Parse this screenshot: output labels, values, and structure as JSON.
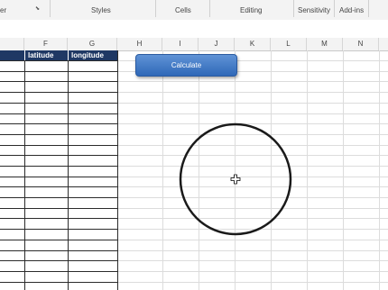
{
  "ribbon": {
    "groups": [
      "er",
      "Styles",
      "Cells",
      "Editing",
      "Sensitivity",
      "Add-ins"
    ],
    "launcher_icon": "dialog-launcher-icon"
  },
  "columns": [
    "F",
    "G",
    "H",
    "I",
    "J",
    "K",
    "L",
    "M",
    "N"
  ],
  "table": {
    "headers": [
      "latitude",
      "longitude"
    ],
    "header_color": "#1f3864"
  },
  "button": {
    "label": "Calculate",
    "color": "#3a76c4"
  },
  "shape": {
    "type": "circle",
    "cursor_icon": "move-cursor-icon"
  },
  "colors": {
    "gridline": "#dcdcdc",
    "table_border": "#2b2b2b",
    "ribbon": "#f3f3f3"
  }
}
